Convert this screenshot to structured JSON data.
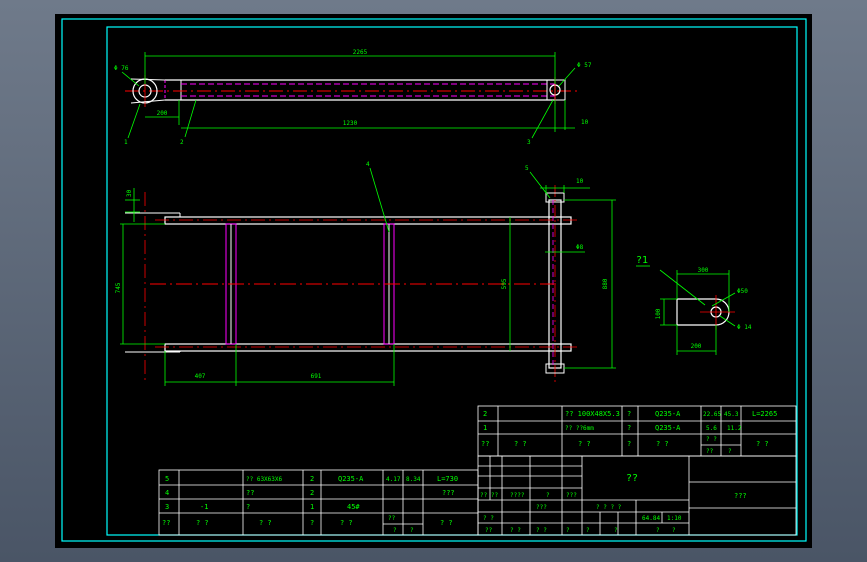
{
  "colors": {
    "background": "#000000",
    "frame": "#00ffff",
    "dimension": "#00ff00",
    "centerline": "#ff0000",
    "hidden": "#ff00ff",
    "outline": "#ffffff",
    "text": "#00ff00",
    "window": "#5a6678"
  },
  "top_view": {
    "dims": {
      "overall_top": "2265",
      "bottom": "1230",
      "left_offset": "200",
      "right_small": "10"
    },
    "hole_labels": {
      "left": "Φ 76",
      "right": "Φ 57"
    },
    "leaders": {
      "left": "1",
      "mid": "2",
      "right": "3"
    }
  },
  "front_view": {
    "leaders": {
      "top_mid": "4",
      "top_right": "5"
    },
    "dims": {
      "top_small": "10",
      "right_mid": "Φ8",
      "left_small": "30",
      "left_height": "745",
      "inner_height": "595",
      "right_height": "880",
      "bottom_left": "407",
      "bottom_mid": "691"
    }
  },
  "detail_view": {
    "title": "?1",
    "dims": {
      "top_width": "300",
      "circle_dia": "Φ50",
      "hole_dia": "Φ 14",
      "left_height": "100",
      "bottom_width": "200"
    }
  },
  "parts_upper": {
    "rows": [
      [
        "2",
        "",
        "?? 100X48X5.3",
        "?",
        "Q235-A",
        "22.65",
        "45.3",
        "L=2265"
      ],
      [
        "1",
        "",
        "?? ??6mm",
        "?",
        "Q235-A",
        "5.6",
        "11.2",
        ""
      ],
      [
        "??",
        "?    ?",
        "?    ?",
        "?",
        "?    ?",
        "? ?",
        "?",
        "?    ?"
      ]
    ],
    "sub_cells": [
      "? ?",
      "??",
      "?"
    ]
  },
  "parts_lower": {
    "rows": [
      [
        "5",
        "",
        "?? 63X63X6",
        "2",
        "Q235-A",
        "4.17",
        "8.34",
        "L=730"
      ],
      [
        "4",
        "",
        "??",
        "2",
        "",
        "",
        "",
        "???"
      ],
      [
        "3",
        "-1",
        "?",
        "1",
        "45#",
        "",
        "",
        ""
      ],
      [
        "??",
        "?    ?",
        "?    ?",
        "?",
        "?    ?",
        "? ?",
        "?",
        "?    ?"
      ]
    ],
    "sub_cells": [
      "??",
      "?",
      "?"
    ]
  },
  "title_block": {
    "drawing_name": "??",
    "company": "???",
    "scale_label": "? ? ? ?",
    "weight": "64.84",
    "scale": "1:10",
    "sheet_labels": [
      "?",
      "?",
      "?",
      "?"
    ],
    "rev_cells": [
      "?? ??",
      "????",
      "?",
      "???"
    ],
    "sign_cells": [
      "? ?",
      "???",
      "??",
      "? ?",
      "? ?",
      "?"
    ]
  }
}
